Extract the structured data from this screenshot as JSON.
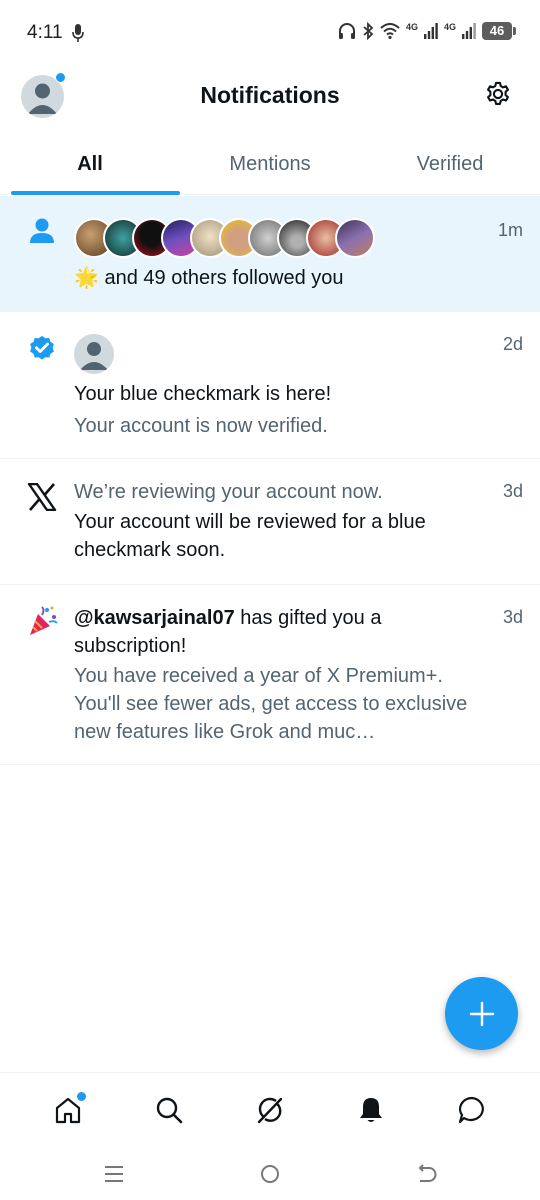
{
  "status_bar": {
    "time": "4:11",
    "network_1": "4G",
    "network_2": "4G",
    "battery": "46"
  },
  "header": {
    "title": "Notifications"
  },
  "tabs": [
    {
      "label": "All",
      "active": true
    },
    {
      "label": "Mentions",
      "active": false
    },
    {
      "label": "Verified",
      "active": false
    }
  ],
  "notifications": [
    {
      "type": "follow",
      "time": "1m",
      "text": "and 49 others followed you",
      "emoji": "🌟",
      "avatar_colors": [
        "#8a6a4a",
        "#1e5a5a",
        "#b01020",
        "#3a3080",
        "#d8c8b0",
        "#e8b830",
        "#7a7a7a",
        "#2a2a2a",
        "#c04040",
        "#8a5a9a"
      ]
    },
    {
      "type": "verified",
      "time": "2d",
      "title": "Your blue checkmark is here!",
      "subtitle": "Your account is now verified."
    },
    {
      "type": "review",
      "time": "3d",
      "title": "We’re reviewing your account now.",
      "body": "Your account will be reviewed for a blue checkmark soon."
    },
    {
      "type": "gift",
      "time": "3d",
      "username": "@kawsarjainal07",
      "action": " has gifted you a subscription!",
      "body": "You have received a year of X Premium+. You'll see fewer ads, get access to exclusive new features like Grok and muc…"
    }
  ],
  "bottom_nav": [
    "home-icon",
    "search-icon",
    "grok-icon",
    "notifications-icon",
    "messages-icon"
  ],
  "colors": {
    "accent": "#1d9bf0",
    "highlight_bg": "#e8f5fd",
    "secondary_text": "#536471"
  }
}
